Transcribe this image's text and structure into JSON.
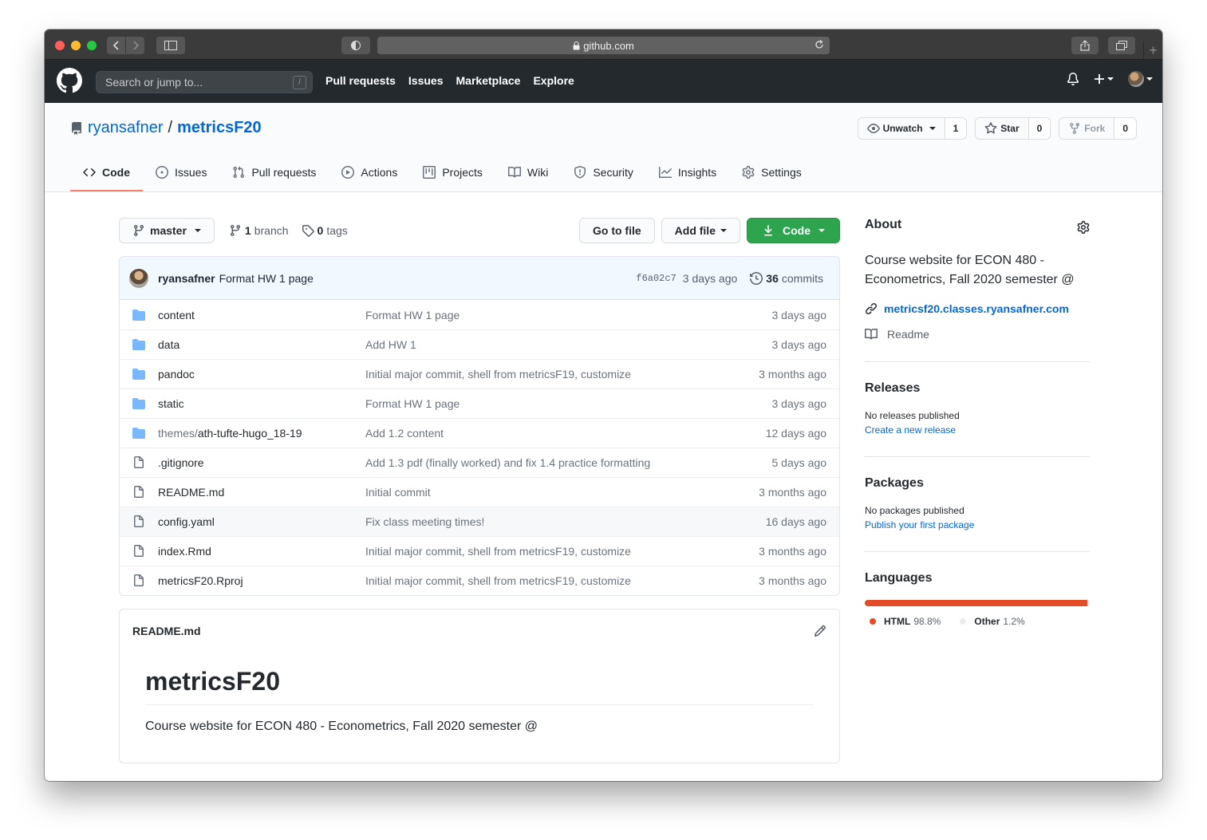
{
  "browser": {
    "url": "github.com"
  },
  "header": {
    "search_placeholder": "Search or jump to...",
    "search_shortcut": "/",
    "nav": [
      "Pull requests",
      "Issues",
      "Marketplace",
      "Explore"
    ]
  },
  "repo": {
    "owner": "ryansafner",
    "separator": "/",
    "name": "metricsF20",
    "watch": {
      "label": "Unwatch",
      "count": "1"
    },
    "star": {
      "label": "Star",
      "count": "0"
    },
    "fork": {
      "label": "Fork",
      "count": "0"
    }
  },
  "tabs": [
    {
      "label": "Code",
      "icon": "code-icon",
      "active": true
    },
    {
      "label": "Issues",
      "icon": "issue-icon"
    },
    {
      "label": "Pull requests",
      "icon": "pull-request-icon"
    },
    {
      "label": "Actions",
      "icon": "play-icon"
    },
    {
      "label": "Projects",
      "icon": "project-icon"
    },
    {
      "label": "Wiki",
      "icon": "book-icon"
    },
    {
      "label": "Security",
      "icon": "shield-icon"
    },
    {
      "label": "Insights",
      "icon": "graph-icon"
    },
    {
      "label": "Settings",
      "icon": "gear-icon"
    }
  ],
  "toolbar": {
    "branch": "master",
    "branch_count": "1",
    "branch_label": "branch",
    "tag_count": "0",
    "tag_label": "tags",
    "goto_file": "Go to file",
    "add_file": "Add file",
    "code": "Code"
  },
  "latest_commit": {
    "author": "ryansafner",
    "message": "Format HW 1 page",
    "sha": "f6a02c7",
    "age": "3 days ago",
    "commit_count": "36",
    "commit_label": "commits"
  },
  "files": [
    {
      "type": "dir",
      "prefix": "",
      "name": "content",
      "message": "Format HW 1 page",
      "age": "3 days ago"
    },
    {
      "type": "dir",
      "prefix": "",
      "name": "data",
      "message": "Add HW 1",
      "age": "3 days ago"
    },
    {
      "type": "dir",
      "prefix": "",
      "name": "pandoc",
      "message": "Initial major commit, shell from metricsF19, customize",
      "age": "3 months ago"
    },
    {
      "type": "dir",
      "prefix": "",
      "name": "static",
      "message": "Format HW 1 page",
      "age": "3 days ago"
    },
    {
      "type": "dir",
      "prefix": "themes/",
      "name": "ath-tufte-hugo_18-19",
      "message": "Add 1.2 content",
      "age": "12 days ago"
    },
    {
      "type": "file",
      "prefix": "",
      "name": ".gitignore",
      "message": "Add 1.3 pdf (finally worked) and fix 1.4 practice formatting",
      "age": "5 days ago"
    },
    {
      "type": "file",
      "prefix": "",
      "name": "README.md",
      "message": "Initial commit",
      "age": "3 months ago"
    },
    {
      "type": "file",
      "prefix": "",
      "name": "config.yaml",
      "message": "Fix class meeting times!",
      "age": "16 days ago"
    },
    {
      "type": "file",
      "prefix": "",
      "name": "index.Rmd",
      "message": "Initial major commit, shell from metricsF19, customize",
      "age": "3 months ago"
    },
    {
      "type": "file",
      "prefix": "",
      "name": "metricsF20.Rproj",
      "message": "Initial major commit, shell from metricsF19, customize",
      "age": "3 months ago"
    }
  ],
  "readme": {
    "filename": "README.md",
    "heading": "metricsF20",
    "body": "Course website for ECON 480 - Econometrics, Fall 2020 semester @"
  },
  "about": {
    "title": "About",
    "description": "Course website for ECON 480 - Econometrics, Fall 2020 semester @",
    "website": "metricsf20.classes.ryansafner.com",
    "readme_label": "Readme"
  },
  "releases": {
    "title": "Releases",
    "status": "No releases published",
    "link": "Create a new release"
  },
  "packages": {
    "title": "Packages",
    "status": "No packages published",
    "link": "Publish your first package"
  },
  "languages": {
    "title": "Languages",
    "items": [
      {
        "name": "HTML",
        "percent": "98.8%",
        "value": 98.8,
        "color": "#e34c26"
      },
      {
        "name": "Other",
        "percent": "1.2%",
        "value": 1.2,
        "color": "#ededed"
      }
    ]
  }
}
